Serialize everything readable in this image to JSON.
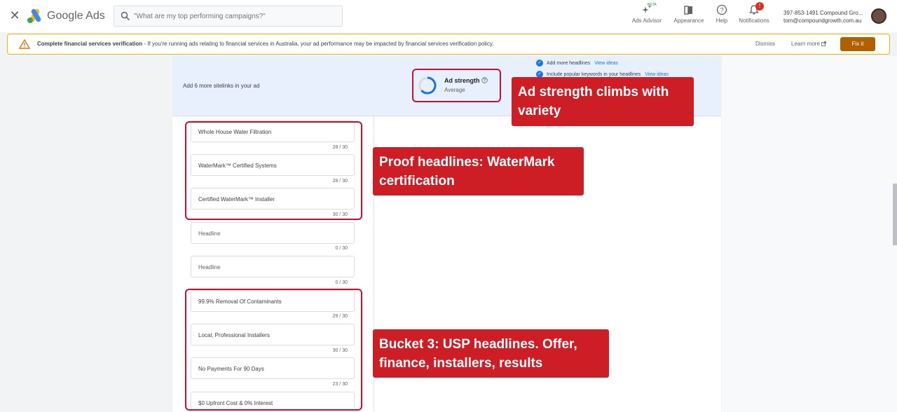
{
  "topbar": {
    "close_glyph": "✕",
    "brand": "Google Ads",
    "search_placeholder": "\"What are my top performing campaigns?\"",
    "tools": {
      "ads_advisor": "Ads Advisor",
      "beta": "BETA",
      "appearance": "Appearance",
      "help": "Help",
      "notifications": "Notifications",
      "notifications_count": "!"
    },
    "account": {
      "phone_name": "397-853-1491 Compound Gro...",
      "email": "tom@compoundgrowth.com.au"
    }
  },
  "banner": {
    "title": "Complete financial services verification",
    "text": " - If you're running ads relating to financial services in Australia, your ad performance may be impacted by financial services verification policy.",
    "dismiss": "Dismiss",
    "learn_more": "Learn more",
    "fix_it": "Fix it"
  },
  "ad_strength": {
    "sitelinks_text": "Add 6 more sitelinks in your ad",
    "title": "Ad strength",
    "value": "Average",
    "tips": [
      {
        "text": "Add more headlines",
        "link": "View ideas"
      },
      {
        "text": "Include popular keywords in your headlines",
        "link": "View ideas"
      }
    ]
  },
  "headlines": [
    {
      "text": "Whole House Water Filtration",
      "count": "28 / 30",
      "placeholder": false
    },
    {
      "text": "WaterMark™ Certified Systems",
      "count": "28 / 30",
      "placeholder": false
    },
    {
      "text": "Certified WaterMark™ Installer",
      "count": "30 / 30",
      "placeholder": false
    },
    {
      "text": "Headline",
      "count": "0 / 30",
      "placeholder": true
    },
    {
      "text": "Headline",
      "count": "0 / 30",
      "placeholder": true
    },
    {
      "text": "99.9% Removal Of Contaminants",
      "count": "29 / 30",
      "placeholder": false
    },
    {
      "text": "Local, Professional Installers",
      "count": "30 / 30",
      "placeholder": false
    },
    {
      "text": "No Payments For 90 Days",
      "count": "23 / 30",
      "placeholder": false
    },
    {
      "text": "$0 Upfront Cost & 0% Interest",
      "count": "",
      "placeholder": false
    }
  ],
  "callouts": {
    "strength": "Ad strength climbs with variety",
    "proof": "Proof headlines: WaterMark certification",
    "usp": "Bucket 3: USP headlines. Offer, finance, installers, results"
  },
  "colors": {
    "callout_red": "#cc1e24",
    "highlight_red": "#c8102e",
    "google_blue": "#1a73e8",
    "fix_button": "#b06000",
    "banner_border": "#f4b400"
  },
  "icons": [
    "close-icon",
    "google-ads-logo",
    "search-icon",
    "ads-advisor-icon",
    "appearance-icon",
    "help-icon",
    "notifications-icon",
    "warning-icon",
    "external-link-icon",
    "check-icon",
    "info-icon"
  ]
}
